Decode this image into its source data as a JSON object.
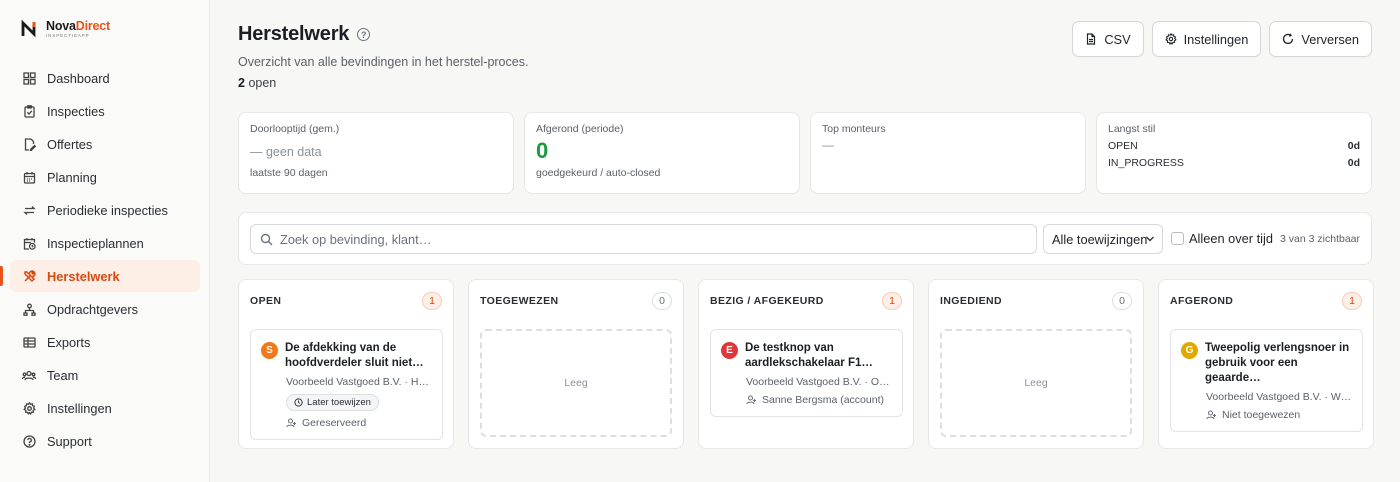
{
  "brand": {
    "name_part1": "Nova",
    "name_part2": "Direct",
    "tagline": "INSPECTIEAPP",
    "accent": "#e8541b"
  },
  "sidebar": {
    "items": [
      {
        "label": "Dashboard",
        "icon": "grid-icon",
        "active": false
      },
      {
        "label": "Inspecties",
        "icon": "clipboard-check-icon",
        "active": false
      },
      {
        "label": "Offertes",
        "icon": "file-edit-icon",
        "active": false
      },
      {
        "label": "Planning",
        "icon": "calendar-icon",
        "active": false
      },
      {
        "label": "Periodieke inspecties",
        "icon": "repeat-icon",
        "active": false
      },
      {
        "label": "Inspectieplannen",
        "icon": "calendar-clock-icon",
        "active": false
      },
      {
        "label": "Herstelwerk",
        "icon": "tools-icon",
        "active": true
      },
      {
        "label": "Opdrachtgevers",
        "icon": "sitemap-icon",
        "active": false
      },
      {
        "label": "Exports",
        "icon": "sheet-icon",
        "active": false
      },
      {
        "label": "Team",
        "icon": "users-icon",
        "active": false
      },
      {
        "label": "Instellingen",
        "icon": "gear-icon",
        "active": false
      },
      {
        "label": "Support",
        "icon": "help-circle-icon",
        "active": false
      }
    ]
  },
  "header": {
    "title": "Herstelwerk",
    "subtitle": "Overzicht van alle bevindingen in het herstel-proces.",
    "open_count": "2",
    "open_label": "open",
    "buttons": {
      "csv": "CSV",
      "settings": "Instellingen",
      "refresh": "Verversen"
    }
  },
  "stats": {
    "lead_time": {
      "label": "Doorlooptijd (gem.)",
      "value": "— geen data",
      "foot": "laatste 90 dagen"
    },
    "completed": {
      "label": "Afgerond (periode)",
      "value": "0",
      "foot": "goedgekeurd / auto-closed"
    },
    "top": {
      "label": "Top monteurs",
      "value": "—"
    },
    "idle": {
      "label": "Langst stil",
      "rows": [
        {
          "key": "OPEN",
          "value": "0d"
        },
        {
          "key": "IN_PROGRESS",
          "value": "0d"
        }
      ]
    }
  },
  "filter": {
    "search_placeholder": "Zoek op bevinding, klant…",
    "assign_select": "Alle toewijzingen",
    "overdue_label": "Alleen over tijd",
    "visible_text": "3 van 3 zichtbaar"
  },
  "columns": [
    {
      "title": "OPEN",
      "count": "1",
      "cards": [
        {
          "avatar": "S",
          "avatar_color": "#f07a1a",
          "title_l1": "De afdekking van de",
          "title_l2": "hoofdverdeler sluit niet…",
          "client": "Voorbeeld Vastgoed B.V. · Ho…",
          "pill": "Later toewijzen",
          "assignee": "Gereserveerd"
        }
      ]
    },
    {
      "title": "TOEGEWEZEN",
      "count": "0",
      "empty": "Leeg"
    },
    {
      "title": "BEZIG / AFGEKEURD",
      "count": "1",
      "cards": [
        {
          "avatar": "E",
          "avatar_color": "#e0363a",
          "title_l1": "De testknop van",
          "title_l2": "aardlekschakelaar F1…",
          "client": "Voorbeeld Vastgoed B.V. · On…",
          "assignee": "Sanne Bergsma (account)"
        }
      ]
    },
    {
      "title": "INGEDIEND",
      "count": "0",
      "empty": "Leeg"
    },
    {
      "title": "AFGEROND",
      "count": "1",
      "cards": [
        {
          "avatar": "G",
          "avatar_color": "#e0a800",
          "title_l1": "Tweepolig verlengsnoer in",
          "title_l2": "gebruik voor een geaarde…",
          "client": "Voorbeeld Vastgoed B.V. · We…",
          "assignee": "Niet toegewezen"
        }
      ]
    }
  ]
}
